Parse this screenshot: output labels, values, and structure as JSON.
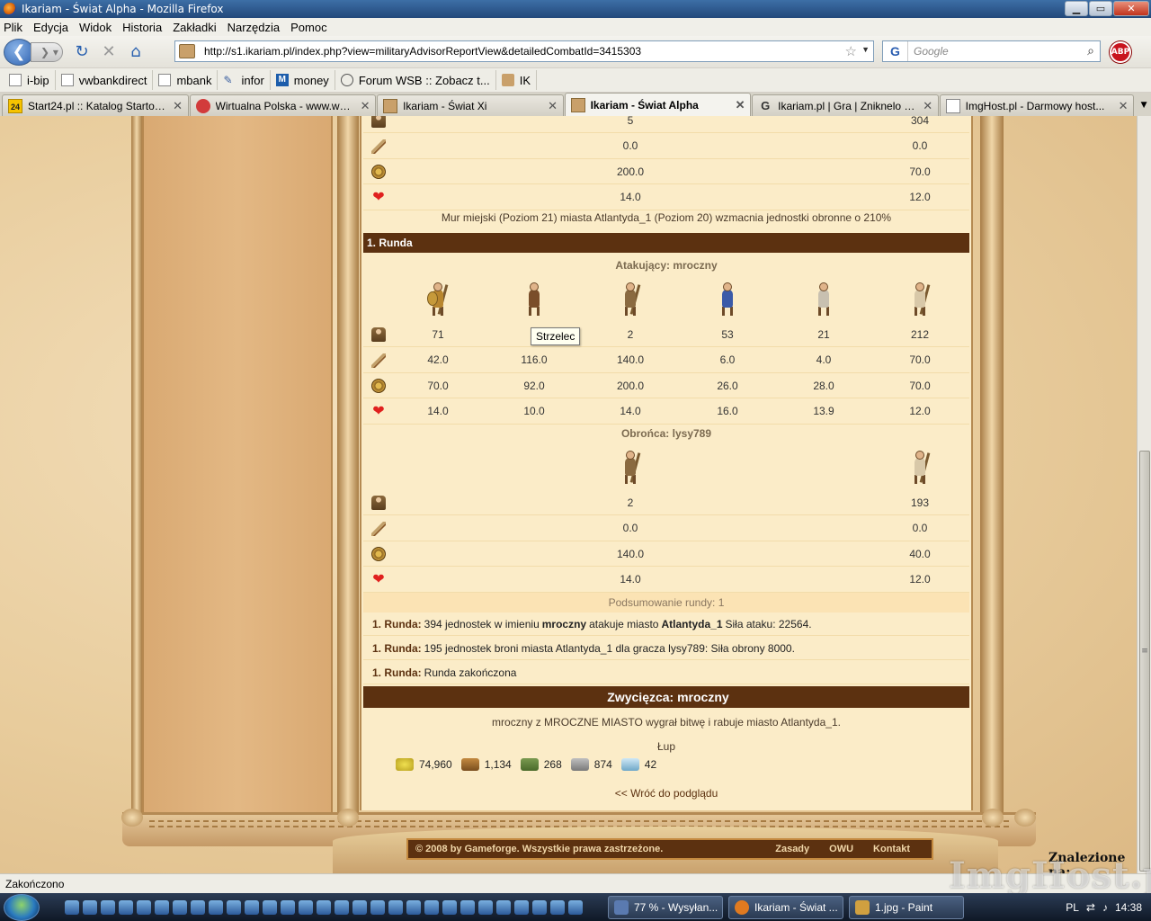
{
  "window": {
    "title": "Ikariam - Świat Alpha - Mozilla Firefox",
    "minimize": "▁",
    "maximize": "▭",
    "close": "✕"
  },
  "menu": [
    "Plik",
    "Edycja",
    "Widok",
    "Historia",
    "Zakładki",
    "Narzędzia",
    "Pomoc"
  ],
  "nav": {
    "url": "http://s1.ikariam.pl/index.php?view=militaryAdvisorReportView&detailedCombatId=3415303",
    "search_placeholder": "Google",
    "search_engine": "G",
    "abp_label": "ABP"
  },
  "bookmarks": [
    {
      "label": "i-bip",
      "icon": "document-icon"
    },
    {
      "label": "vwbankdirect",
      "icon": "document-icon"
    },
    {
      "label": "mbank",
      "icon": "document-icon"
    },
    {
      "label": "infor",
      "icon": "tool-icon"
    },
    {
      "label": "money",
      "icon": "m-logo-icon"
    },
    {
      "label": "Forum WSB :: Zobacz t...",
      "icon": "onet-icon"
    },
    {
      "label": "IK",
      "icon": "ikariam-icon"
    }
  ],
  "tabs": [
    {
      "label": "Start24.pl :: Katalog Startow...",
      "icon": "start24-icon",
      "active": false
    },
    {
      "label": "Wirtualna Polska - www.wp....",
      "icon": "wp-icon",
      "active": false
    },
    {
      "label": "Ikariam - Świat Xi",
      "icon": "ikariam-icon",
      "active": false
    },
    {
      "label": "Ikariam - Świat Alpha",
      "icon": "ikariam-icon",
      "active": true
    },
    {
      "label": "Ikariam.pl | Gra | Zniknelo m...",
      "icon": "g-logo-icon",
      "active": false
    },
    {
      "label": "ImgHost.pl - Darmowy host...",
      "icon": "document-icon",
      "active": false
    }
  ],
  "report": {
    "top_rows": [
      {
        "type": "units",
        "values": [
          "5",
          "304"
        ]
      },
      {
        "type": "attack",
        "values": [
          "0.0",
          "0.0"
        ]
      },
      {
        "type": "armor",
        "values": [
          "200.0",
          "70.0"
        ]
      },
      {
        "type": "health",
        "values": [
          "14.0",
          "12.0"
        ]
      }
    ],
    "wall_note": "Mur miejski (Poziom 21) miasta Atlantyda_1 (Poziom 20) wzmacnia jednostki obronne o 210%",
    "round_title": "1. Runda",
    "attacker_title": "Atakujący: mroczny",
    "attacker_units": [
      "hoplite-icon",
      "archer-icon",
      "ram-icon",
      "cook-icon",
      "doctor-icon",
      "swordsman-icon"
    ],
    "attacker_rows": [
      {
        "type": "units",
        "values": [
          "71",
          "",
          "2",
          "53",
          "21",
          "212"
        ]
      },
      {
        "type": "attack",
        "values": [
          "42.0",
          "116.0",
          "140.0",
          "6.0",
          "4.0",
          "70.0"
        ]
      },
      {
        "type": "armor",
        "values": [
          "70.0",
          "92.0",
          "200.0",
          "26.0",
          "28.0",
          "70.0"
        ]
      },
      {
        "type": "health",
        "values": [
          "14.0",
          "10.0",
          "14.0",
          "16.0",
          "13.9",
          "12.0"
        ]
      }
    ],
    "tooltip": "Strzelec",
    "defender_title": "Obrońca: lysy789",
    "defender_units": [
      "ram-icon",
      "swordsman-icon"
    ],
    "defender_rows": [
      {
        "type": "units",
        "values": [
          "2",
          "193"
        ]
      },
      {
        "type": "attack",
        "values": [
          "0.0",
          "0.0"
        ]
      },
      {
        "type": "armor",
        "values": [
          "140.0",
          "40.0"
        ]
      },
      {
        "type": "health",
        "values": [
          "14.0",
          "12.0"
        ]
      }
    ],
    "summary_title": "Podsumowanie rundy: 1",
    "summary_lines": [
      {
        "prefix": "1. Runda:",
        "text_a": "394 jednostek w imieniu",
        "bold_a": "mroczny",
        "text_b": "atakuje miasto",
        "bold_b": "Atlantyda_1",
        "text_c": "Siła ataku: 22564."
      },
      {
        "prefix": "1. Runda:",
        "text_a": "195 jednostek broni miasta Atlantyda_1 dla gracza lysy789: Siła obrony 8000.",
        "bold_a": "",
        "text_b": "",
        "bold_b": "",
        "text_c": ""
      },
      {
        "prefix": "1. Runda:",
        "text_a": "Runda zakończona",
        "bold_a": "",
        "text_b": "",
        "bold_b": "",
        "text_c": ""
      }
    ],
    "winner_title": "Zwycięzca: mroczny",
    "winner_text": "mroczny z MROCZNE MIASTO wygrał bitwę i rabuje miasto Atlantyda_1.",
    "loot_title": "Łup",
    "loot": [
      {
        "icon": "wine-icon",
        "value": "74,960"
      },
      {
        "icon": "wood-icon",
        "value": "1,134"
      },
      {
        "icon": "marble-icon",
        "value": "268"
      },
      {
        "icon": "stone-icon",
        "value": "874"
      },
      {
        "icon": "crystal-icon",
        "value": "42"
      }
    ],
    "back_link": "<< Wróć do podglądu"
  },
  "footer": {
    "copyright": "© 2008 by Gameforge. Wszystkie prawa zastrzeżone.",
    "links": [
      "Zasady",
      "OWU",
      "Kontakt"
    ]
  },
  "found_on": "Znalezione na:",
  "watermark": "ImgHost.pl",
  "status": "Zakończono",
  "taskbar": {
    "buttons": [
      {
        "label": "77 % - Wysyłan...",
        "color": "#5a7ab0"
      },
      {
        "label": "Ikariam - Świat ...",
        "color": "#e07a20"
      },
      {
        "label": "1.jpg - Paint",
        "color": "#d0a040"
      }
    ],
    "lang": "PL",
    "clock": "14:38"
  }
}
